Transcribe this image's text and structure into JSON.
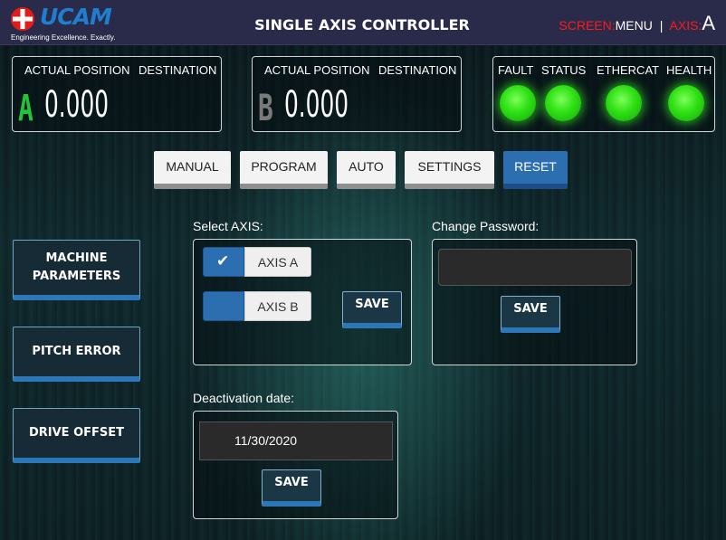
{
  "header": {
    "logo_text": "UCAM",
    "tagline": "Engineering Excellence. Exactly.",
    "title": "SINGLE AXIS CONTROLLER",
    "screen_label": "SCREEN:",
    "screen_value": "MENU",
    "separator": "|",
    "axis_label": "AXIS:",
    "axis_value": "A"
  },
  "axis_panels": [
    {
      "letter": "A",
      "actual_label": "ACTUAL POSITION",
      "dest_label": "DESTINATION",
      "value": "0.000",
      "letter_color": "#22c43a"
    },
    {
      "letter": "B",
      "actual_label": "ACTUAL POSITION",
      "dest_label": "DESTINATION",
      "value": "0.000",
      "letter_color": "#7a7a7a"
    }
  ],
  "status": {
    "labels": [
      "FAULT",
      "STATUS",
      "ETHERCAT",
      "HEALTH"
    ],
    "led_color": "#2ee014"
  },
  "tabs": [
    "MANUAL",
    "PROGRAM",
    "AUTO",
    "SETTINGS",
    "RESET"
  ],
  "active_tab": "RESET",
  "sidebar": {
    "machine_parameters": "MACHINE PARAMETERS",
    "pitch_error": "PITCH ERROR",
    "drive_offset": "DRIVE OFFSET"
  },
  "select_axis": {
    "label": "Select AXIS:",
    "options": [
      {
        "label": "AXIS A",
        "checked": true,
        "mark": "✔"
      },
      {
        "label": "AXIS B",
        "checked": false,
        "mark": ""
      }
    ],
    "save_label": "SAVE"
  },
  "change_password": {
    "label": "Change Password:",
    "value": "",
    "save_label": "SAVE"
  },
  "deactivation": {
    "label": "Deactivation date:",
    "value": "11/30/2020",
    "save_label": "SAVE"
  },
  "colors": {
    "header_bg": "#2a2a4a",
    "accent_blue": "#2c6fb0",
    "alert_red": "#ff1a1a"
  }
}
